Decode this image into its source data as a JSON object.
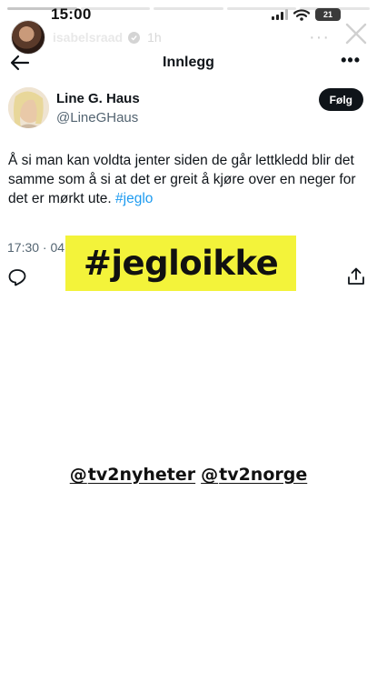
{
  "story": {
    "username": "isabelsraad",
    "time_ago": "1h",
    "more_label": "···"
  },
  "status_bar": {
    "time": "15:00",
    "battery": "21"
  },
  "post_header": {
    "title": "Innlegg",
    "more_label": "•••"
  },
  "author": {
    "name": "Line G. Haus",
    "handle": "@LineGHaus",
    "follow_label": "Følg"
  },
  "tweet": {
    "text": "Å si man kan voldta jenter siden de går lettkledd blir det samme som å si at det er greit å kjøre over en neger for det er mørkt ute.",
    "hashtag": "#jeglo",
    "timestamp": "17:30 · 04"
  },
  "stickers": {
    "hashtag": "#jegloikke",
    "hashtag_bg": "#f3f33a",
    "mentions": [
      "tv2nyheter",
      "tv2norge"
    ],
    "mention_glyph": "@"
  },
  "colors": {
    "link": "#1d9bf0",
    "text": "#0f1419",
    "muted": "#536471"
  },
  "icons": {
    "back": "arrow-left-icon",
    "close": "close-icon",
    "reply": "reply-icon",
    "share": "share-icon",
    "verified": "verified-badge-icon"
  }
}
